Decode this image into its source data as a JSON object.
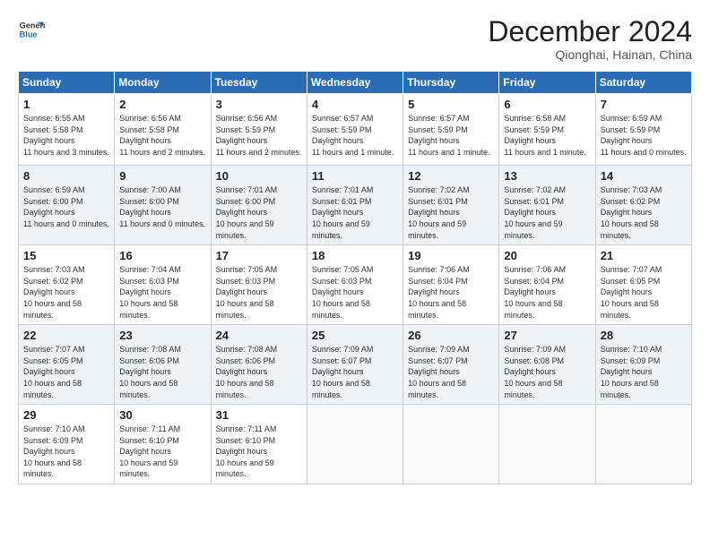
{
  "header": {
    "logo_line1": "General",
    "logo_line2": "Blue",
    "month": "December 2024",
    "location": "Qionghai, Hainan, China"
  },
  "days_of_week": [
    "Sunday",
    "Monday",
    "Tuesday",
    "Wednesday",
    "Thursday",
    "Friday",
    "Saturday"
  ],
  "weeks": [
    [
      {
        "day": "1",
        "sunrise": "6:55 AM",
        "sunset": "5:58 PM",
        "daylight": "11 hours and 3 minutes."
      },
      {
        "day": "2",
        "sunrise": "6:56 AM",
        "sunset": "5:58 PM",
        "daylight": "11 hours and 2 minutes."
      },
      {
        "day": "3",
        "sunrise": "6:56 AM",
        "sunset": "5:59 PM",
        "daylight": "11 hours and 2 minutes."
      },
      {
        "day": "4",
        "sunrise": "6:57 AM",
        "sunset": "5:59 PM",
        "daylight": "11 hours and 1 minute."
      },
      {
        "day": "5",
        "sunrise": "6:57 AM",
        "sunset": "5:59 PM",
        "daylight": "11 hours and 1 minute."
      },
      {
        "day": "6",
        "sunrise": "6:58 AM",
        "sunset": "5:59 PM",
        "daylight": "11 hours and 1 minute."
      },
      {
        "day": "7",
        "sunrise": "6:59 AM",
        "sunset": "5:59 PM",
        "daylight": "11 hours and 0 minutes."
      }
    ],
    [
      {
        "day": "8",
        "sunrise": "6:59 AM",
        "sunset": "6:00 PM",
        "daylight": "11 hours and 0 minutes."
      },
      {
        "day": "9",
        "sunrise": "7:00 AM",
        "sunset": "6:00 PM",
        "daylight": "11 hours and 0 minutes."
      },
      {
        "day": "10",
        "sunrise": "7:01 AM",
        "sunset": "6:00 PM",
        "daylight": "10 hours and 59 minutes."
      },
      {
        "day": "11",
        "sunrise": "7:01 AM",
        "sunset": "6:01 PM",
        "daylight": "10 hours and 59 minutes."
      },
      {
        "day": "12",
        "sunrise": "7:02 AM",
        "sunset": "6:01 PM",
        "daylight": "10 hours and 59 minutes."
      },
      {
        "day": "13",
        "sunrise": "7:02 AM",
        "sunset": "6:01 PM",
        "daylight": "10 hours and 59 minutes."
      },
      {
        "day": "14",
        "sunrise": "7:03 AM",
        "sunset": "6:02 PM",
        "daylight": "10 hours and 58 minutes."
      }
    ],
    [
      {
        "day": "15",
        "sunrise": "7:03 AM",
        "sunset": "6:02 PM",
        "daylight": "10 hours and 58 minutes."
      },
      {
        "day": "16",
        "sunrise": "7:04 AM",
        "sunset": "6:03 PM",
        "daylight": "10 hours and 58 minutes."
      },
      {
        "day": "17",
        "sunrise": "7:05 AM",
        "sunset": "6:03 PM",
        "daylight": "10 hours and 58 minutes."
      },
      {
        "day": "18",
        "sunrise": "7:05 AM",
        "sunset": "6:03 PM",
        "daylight": "10 hours and 58 minutes."
      },
      {
        "day": "19",
        "sunrise": "7:06 AM",
        "sunset": "6:04 PM",
        "daylight": "10 hours and 58 minutes."
      },
      {
        "day": "20",
        "sunrise": "7:06 AM",
        "sunset": "6:04 PM",
        "daylight": "10 hours and 58 minutes."
      },
      {
        "day": "21",
        "sunrise": "7:07 AM",
        "sunset": "6:05 PM",
        "daylight": "10 hours and 58 minutes."
      }
    ],
    [
      {
        "day": "22",
        "sunrise": "7:07 AM",
        "sunset": "6:05 PM",
        "daylight": "10 hours and 58 minutes."
      },
      {
        "day": "23",
        "sunrise": "7:08 AM",
        "sunset": "6:06 PM",
        "daylight": "10 hours and 58 minutes."
      },
      {
        "day": "24",
        "sunrise": "7:08 AM",
        "sunset": "6:06 PM",
        "daylight": "10 hours and 58 minutes."
      },
      {
        "day": "25",
        "sunrise": "7:09 AM",
        "sunset": "6:07 PM",
        "daylight": "10 hours and 58 minutes."
      },
      {
        "day": "26",
        "sunrise": "7:09 AM",
        "sunset": "6:07 PM",
        "daylight": "10 hours and 58 minutes."
      },
      {
        "day": "27",
        "sunrise": "7:09 AM",
        "sunset": "6:08 PM",
        "daylight": "10 hours and 58 minutes."
      },
      {
        "day": "28",
        "sunrise": "7:10 AM",
        "sunset": "6:09 PM",
        "daylight": "10 hours and 58 minutes."
      }
    ],
    [
      {
        "day": "29",
        "sunrise": "7:10 AM",
        "sunset": "6:09 PM",
        "daylight": "10 hours and 58 minutes."
      },
      {
        "day": "30",
        "sunrise": "7:11 AM",
        "sunset": "6:10 PM",
        "daylight": "10 hours and 59 minutes."
      },
      {
        "day": "31",
        "sunrise": "7:11 AM",
        "sunset": "6:10 PM",
        "daylight": "10 hours and 59 minutes."
      },
      null,
      null,
      null,
      null
    ]
  ]
}
